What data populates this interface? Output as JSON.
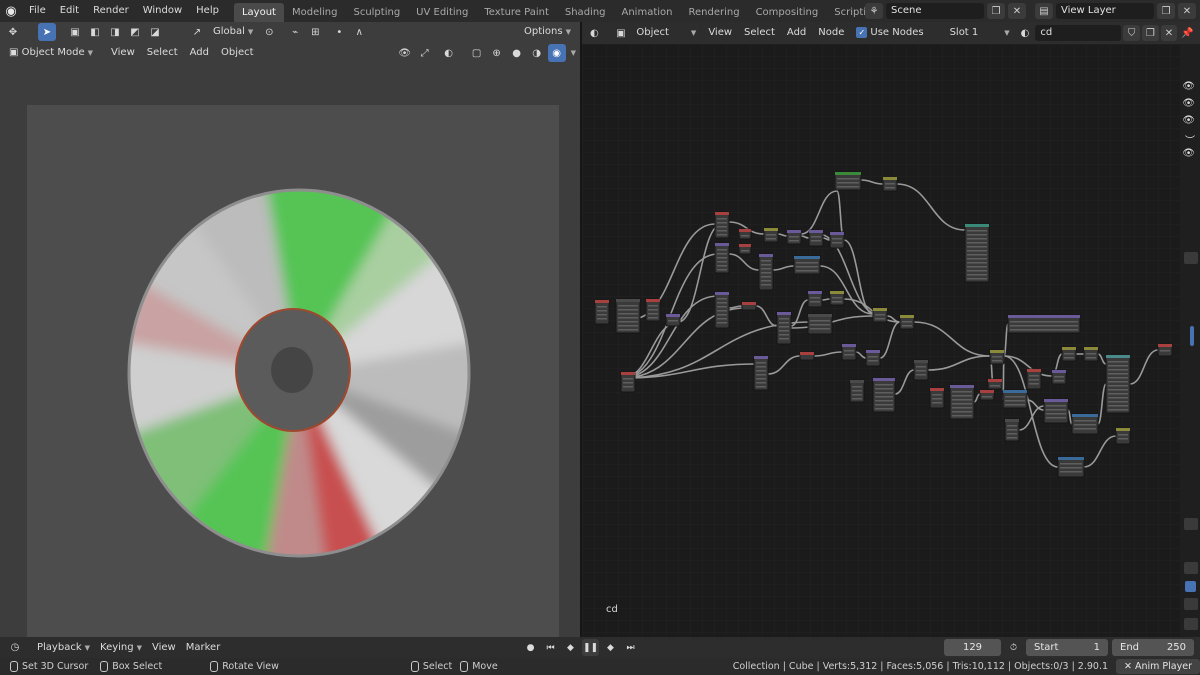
{
  "app": {
    "menus": [
      "File",
      "Edit",
      "Render",
      "Window",
      "Help"
    ],
    "workspaces": [
      "Layout",
      "Modeling",
      "Sculpting",
      "UV Editing",
      "Texture Paint",
      "Shading",
      "Animation",
      "Rendering",
      "Compositing",
      "Scripting"
    ],
    "active_workspace": "Layout",
    "scene": "Scene",
    "view_layer": "View Layer"
  },
  "viewport": {
    "orientation": "Global",
    "options_label": "Options",
    "mode": "Object Mode",
    "menu": [
      "View",
      "Select",
      "Add",
      "Object"
    ],
    "cd_colors": {
      "silver": "#bcbcbc",
      "green": "#55c455",
      "red": "#c85050",
      "hub": "#5b5b5b",
      "hole": "#454545",
      "ring": "#a0482e"
    }
  },
  "node_editor": {
    "type": "Object",
    "menu": [
      "View",
      "Select",
      "Add",
      "Node"
    ],
    "use_nodes": "Use Nodes",
    "slot": "Slot 1",
    "material": "cd",
    "canvas_label": "cd"
  },
  "timeline": {
    "menu": [
      "Playback",
      "Keying",
      "View",
      "Marker"
    ],
    "current_frame": "129",
    "start_label": "Start",
    "start_value": "1",
    "end_label": "End",
    "end_value": "250"
  },
  "status": {
    "set_cursor": "Set 3D Cursor",
    "box_select": "Box Select",
    "rotate_view": "Rotate View",
    "select": "Select",
    "move": "Move",
    "stats": "Collection | Cube | Verts:5,312 | Faces:5,056 | Tris:10,112 | Objects:0/3 | 2.90.1",
    "anim_player": "Anim Player"
  }
}
